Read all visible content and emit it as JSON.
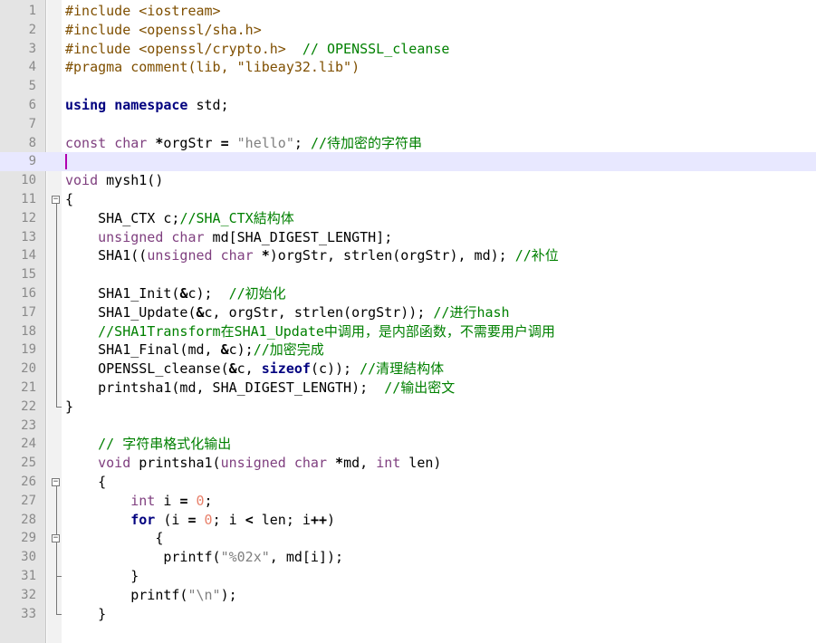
{
  "editor": {
    "line_numbers": [
      "1",
      "2",
      "3",
      "4",
      "5",
      "6",
      "7",
      "8",
      "9",
      "10",
      "11",
      "12",
      "13",
      "14",
      "15",
      "16",
      "17",
      "18",
      "19",
      "20",
      "21",
      "22",
      "23",
      "24",
      "25",
      "26",
      "27",
      "28",
      "29",
      "30",
      "31",
      "32",
      "33"
    ],
    "current_line": 9,
    "lines": [
      [
        {
          "t": "pp",
          "s": "#include <iostream>"
        }
      ],
      [
        {
          "t": "pp",
          "s": "#include <openssl/sha.h>"
        }
      ],
      [
        {
          "t": "pp",
          "s": "#include <openssl/crypto.h>  "
        },
        {
          "t": "cm",
          "s": "// OPENSSL_cleanse"
        }
      ],
      [
        {
          "t": "pp",
          "s": "#pragma comment(lib, \"libeay32.lib\")"
        }
      ],
      [],
      [
        {
          "t": "kw",
          "s": "using"
        },
        {
          "t": "tx",
          "s": " "
        },
        {
          "t": "kw",
          "s": "namespace"
        },
        {
          "t": "tx",
          "s": " std;"
        }
      ],
      [],
      [
        {
          "t": "ty",
          "s": "const"
        },
        {
          "t": "tx",
          "s": " "
        },
        {
          "t": "ty",
          "s": "char"
        },
        {
          "t": "tx",
          "s": " "
        },
        {
          "t": "op",
          "s": "*"
        },
        {
          "t": "tx",
          "s": "orgStr "
        },
        {
          "t": "op",
          "s": "="
        },
        {
          "t": "tx",
          "s": " "
        },
        {
          "t": "str",
          "s": "\"hello\""
        },
        {
          "t": "tx",
          "s": "; "
        },
        {
          "t": "cm",
          "s": "//待加密的字符串"
        }
      ],
      [],
      [
        {
          "t": "ty",
          "s": "void"
        },
        {
          "t": "tx",
          "s": " mysh1()"
        }
      ],
      [
        {
          "t": "tx",
          "s": "{"
        }
      ],
      [
        {
          "t": "tx",
          "s": "    SHA_CTX c;"
        },
        {
          "t": "cm",
          "s": "//SHA_CTX結构体"
        }
      ],
      [
        {
          "t": "tx",
          "s": "    "
        },
        {
          "t": "ty",
          "s": "unsigned"
        },
        {
          "t": "tx",
          "s": " "
        },
        {
          "t": "ty",
          "s": "char"
        },
        {
          "t": "tx",
          "s": " md[SHA_DIGEST_LENGTH];"
        }
      ],
      [
        {
          "t": "tx",
          "s": "    SHA1(("
        },
        {
          "t": "ty",
          "s": "unsigned"
        },
        {
          "t": "tx",
          "s": " "
        },
        {
          "t": "ty",
          "s": "char"
        },
        {
          "t": "tx",
          "s": " "
        },
        {
          "t": "op",
          "s": "*"
        },
        {
          "t": "tx",
          "s": ")orgStr, strlen(orgStr), md); "
        },
        {
          "t": "cm",
          "s": "//补位"
        }
      ],
      [],
      [
        {
          "t": "tx",
          "s": "    SHA1_Init("
        },
        {
          "t": "op",
          "s": "&"
        },
        {
          "t": "tx",
          "s": "c);  "
        },
        {
          "t": "cm",
          "s": "//初始化"
        }
      ],
      [
        {
          "t": "tx",
          "s": "    SHA1_Update("
        },
        {
          "t": "op",
          "s": "&"
        },
        {
          "t": "tx",
          "s": "c, orgStr, strlen(orgStr)); "
        },
        {
          "t": "cm",
          "s": "//进行hash"
        }
      ],
      [
        {
          "t": "tx",
          "s": "    "
        },
        {
          "t": "cm",
          "s": "//SHA1Transform在SHA1_Update中调用，是内部函数，不需要用户调用"
        }
      ],
      [
        {
          "t": "tx",
          "s": "    SHA1_Final(md, "
        },
        {
          "t": "op",
          "s": "&"
        },
        {
          "t": "tx",
          "s": "c);"
        },
        {
          "t": "cm",
          "s": "//加密完成"
        }
      ],
      [
        {
          "t": "tx",
          "s": "    OPENSSL_cleanse("
        },
        {
          "t": "op",
          "s": "&"
        },
        {
          "t": "tx",
          "s": "c, "
        },
        {
          "t": "kw",
          "s": "sizeof"
        },
        {
          "t": "tx",
          "s": "(c)); "
        },
        {
          "t": "cm",
          "s": "//清理結构体"
        }
      ],
      [
        {
          "t": "tx",
          "s": "    printsha1(md, SHA_DIGEST_LENGTH);  "
        },
        {
          "t": "cm",
          "s": "//输出密文"
        }
      ],
      [
        {
          "t": "tx",
          "s": "}"
        }
      ],
      [],
      [
        {
          "t": "tx",
          "s": "    "
        },
        {
          "t": "cm",
          "s": "// 字符串格式化输出"
        }
      ],
      [
        {
          "t": "tx",
          "s": "    "
        },
        {
          "t": "ty",
          "s": "void"
        },
        {
          "t": "tx",
          "s": " printsha1("
        },
        {
          "t": "ty",
          "s": "unsigned"
        },
        {
          "t": "tx",
          "s": " "
        },
        {
          "t": "ty",
          "s": "char"
        },
        {
          "t": "tx",
          "s": " "
        },
        {
          "t": "op",
          "s": "*"
        },
        {
          "t": "tx",
          "s": "md, "
        },
        {
          "t": "ty",
          "s": "int"
        },
        {
          "t": "tx",
          "s": " len)"
        }
      ],
      [
        {
          "t": "tx",
          "s": "    {"
        }
      ],
      [
        {
          "t": "tx",
          "s": "        "
        },
        {
          "t": "ty",
          "s": "int"
        },
        {
          "t": "tx",
          "s": " i "
        },
        {
          "t": "op",
          "s": "="
        },
        {
          "t": "tx",
          "s": " "
        },
        {
          "t": "num",
          "s": "0"
        },
        {
          "t": "tx",
          "s": ";"
        }
      ],
      [
        {
          "t": "tx",
          "s": "        "
        },
        {
          "t": "kw",
          "s": "for"
        },
        {
          "t": "tx",
          "s": " (i "
        },
        {
          "t": "op",
          "s": "="
        },
        {
          "t": "tx",
          "s": " "
        },
        {
          "t": "num",
          "s": "0"
        },
        {
          "t": "tx",
          "s": "; i "
        },
        {
          "t": "op",
          "s": "<"
        },
        {
          "t": "tx",
          "s": " len; i"
        },
        {
          "t": "op",
          "s": "++"
        },
        {
          "t": "tx",
          "s": ")"
        }
      ],
      [
        {
          "t": "tx",
          "s": "           {"
        }
      ],
      [
        {
          "t": "tx",
          "s": "            printf("
        },
        {
          "t": "str",
          "s": "\"%02x\""
        },
        {
          "t": "tx",
          "s": ", md[i]);"
        }
      ],
      [
        {
          "t": "tx",
          "s": "        }"
        }
      ],
      [
        {
          "t": "tx",
          "s": "        printf("
        },
        {
          "t": "str",
          "s": "\"\\n\""
        },
        {
          "t": "tx",
          "s": ");"
        }
      ],
      [
        {
          "t": "tx",
          "s": "    }"
        }
      ]
    ],
    "fold_markers": [
      {
        "line": 11,
        "symbol": "⊟"
      },
      {
        "line": 26,
        "symbol": "⊟"
      },
      {
        "line": 29,
        "symbol": "⊟"
      }
    ],
    "colors": {
      "preprocessor": "#7f4f00",
      "keyword": "#00007f",
      "type": "#7f3f7f",
      "string": "#7f7f7f",
      "number": "#e8806a",
      "comment": "#008000",
      "current_line_bg": "#e8e8ff",
      "gutter_bg": "#e4e4e4"
    }
  }
}
